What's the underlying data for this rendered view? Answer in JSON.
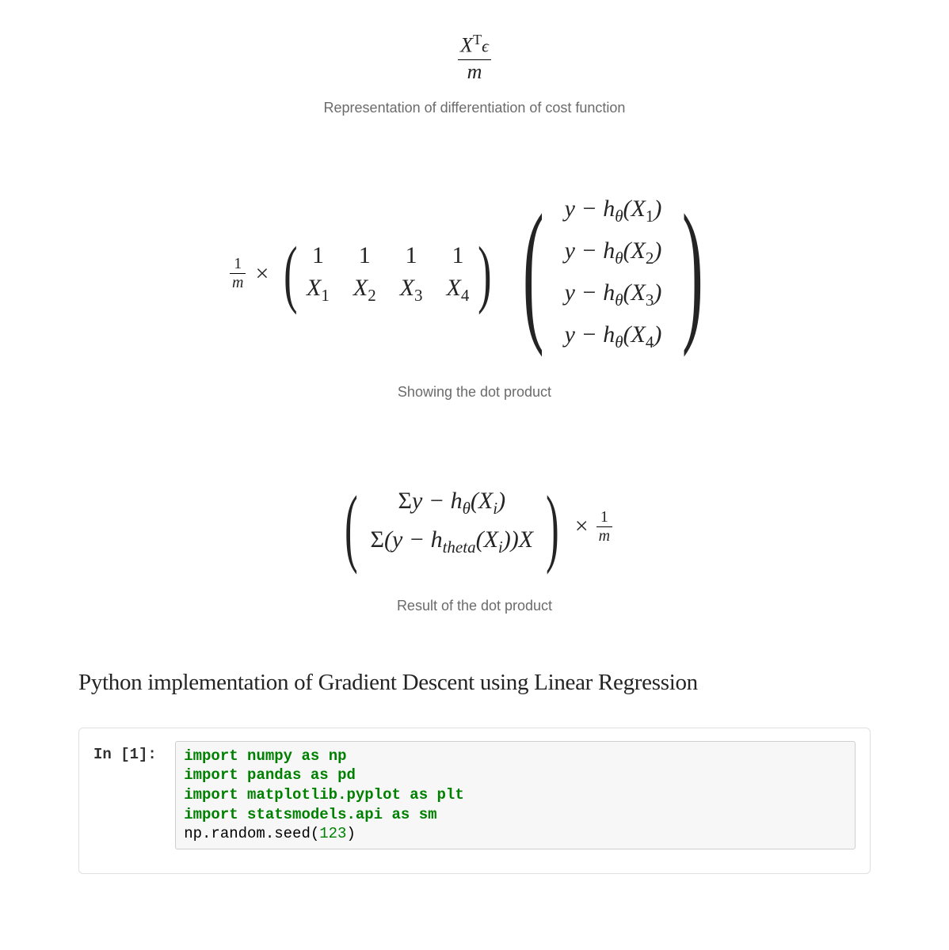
{
  "formula1": {
    "numerator_x": "X",
    "numerator_sup": "T",
    "numerator_eps": "ϵ",
    "denominator": "m",
    "caption": "Representation of differentiation of cost function"
  },
  "formula2": {
    "frac_num": "1",
    "frac_den": "m",
    "times": "×",
    "row1": [
      "1",
      "1",
      "1",
      "1"
    ],
    "row2": [
      "X₁",
      "X₂",
      "X₃",
      "X₄"
    ],
    "vec": [
      "y − h_θ(X₁)",
      "y − h_θ(X₂)",
      "y − h_θ(X₃)",
      "y − h_θ(X₄)"
    ],
    "caption": "Showing the dot product"
  },
  "formula3": {
    "row1": "Σy − h_θ(X_i)",
    "row2": "Σ(y − h_theta(X_i))X",
    "times": "×",
    "frac_num": "1",
    "frac_den": "m",
    "caption": "Result of the dot product"
  },
  "heading": "Python implementation of Gradient Descent using Linear Regression",
  "code": {
    "prompt": "In [1]: ",
    "lines": [
      {
        "type": "import",
        "kw": "import",
        "mod": "numpy",
        "as": "as",
        "alias": "np"
      },
      {
        "type": "import",
        "kw": "import",
        "mod": "pandas",
        "as": "as",
        "alias": "pd"
      },
      {
        "type": "import",
        "kw": "import",
        "mod": "matplotlib.pyplot",
        "as": "as",
        "alias": "plt"
      },
      {
        "type": "import",
        "kw": "import",
        "mod": "statsmodels.api",
        "as": "as",
        "alias": "sm"
      },
      {
        "type": "call",
        "text": "np.random.seed(",
        "num": "123",
        "close": ")"
      }
    ]
  }
}
